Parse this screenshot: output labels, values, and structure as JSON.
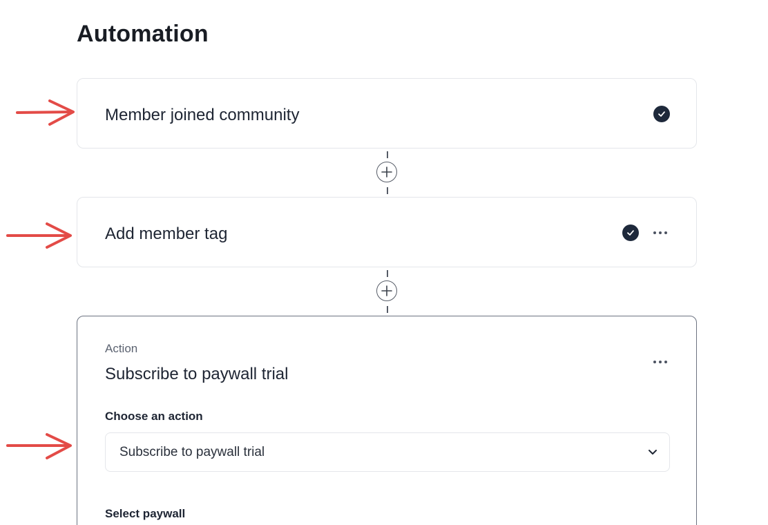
{
  "page": {
    "title": "Automation"
  },
  "steps": {
    "trigger": {
      "label": "Member joined community",
      "status": "completed"
    },
    "tag": {
      "label": "Add member tag",
      "status": "completed"
    },
    "action": {
      "type_label": "Action",
      "title": "Subscribe to paywall trial",
      "choose_action_label": "Choose an action",
      "selected_action": "Subscribe to paywall trial",
      "select_paywall_label": "Select paywall"
    }
  },
  "icons": {
    "check": "check-circle-icon",
    "more": "more-horizontal-icon",
    "add": "plus-circle-icon",
    "chevron": "chevron-down-icon",
    "arrow": "red-arrow-icon"
  },
  "colors": {
    "check_bg": "#1e293b",
    "annotation_arrow": "#e34b47",
    "card_border": "#e4e6ea",
    "active_card_border": "#6b7280"
  }
}
